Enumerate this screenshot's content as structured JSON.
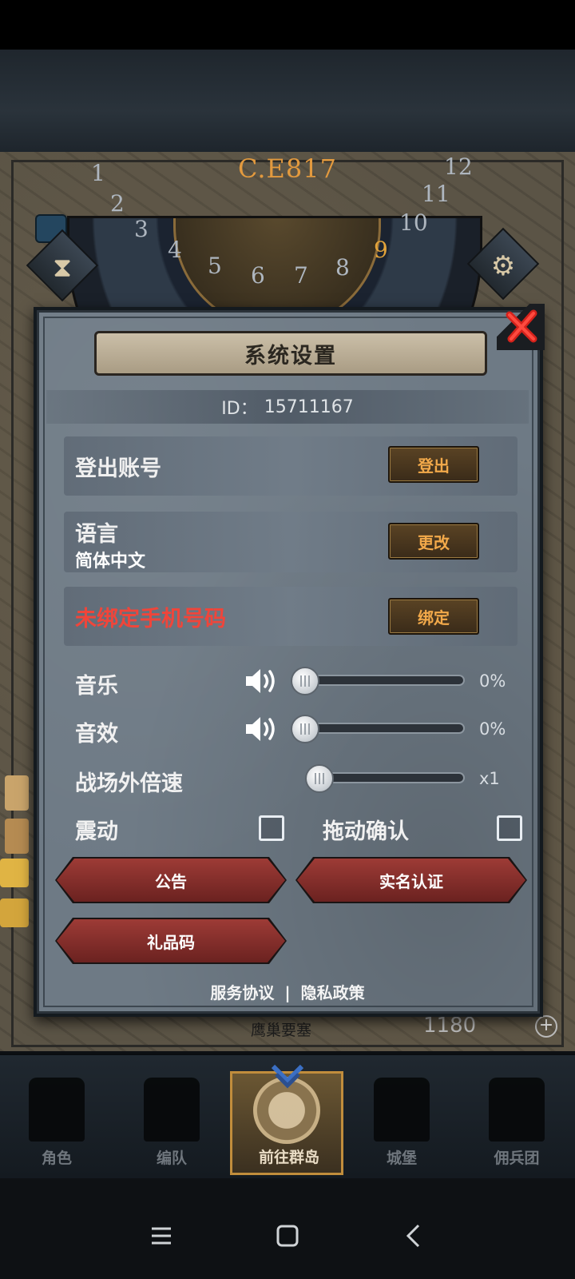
{
  "era": {
    "label": "C.E817",
    "dial_numbers": [
      "1",
      "2",
      "3",
      "4",
      "5",
      "6",
      "7",
      "8",
      "9",
      "10",
      "11",
      "12"
    ],
    "current": "9"
  },
  "dialog": {
    "title": "系统设置",
    "id_label": "ID：",
    "id_value": "15711167",
    "logout": {
      "label": "登出账号",
      "button": "登出"
    },
    "language": {
      "label": "语言",
      "value": "简体中文",
      "button": "更改"
    },
    "phone": {
      "label": "未绑定手机号码",
      "button": "绑定"
    },
    "music": {
      "label": "音乐",
      "value_text": "0%",
      "level": 0
    },
    "sfx": {
      "label": "音效",
      "value_text": "0%",
      "level": 0
    },
    "speed": {
      "label": "战场外倍速",
      "value_text": "x1",
      "level": 0
    },
    "vibrate": {
      "label": "震动",
      "checked": false
    },
    "drag_confirm": {
      "label": "拖动确认",
      "checked": false
    },
    "buttons": {
      "notice": "公告",
      "realname": "实名认证",
      "gift_code": "礼品码"
    },
    "links": {
      "terms": "服务协议",
      "separator": "|",
      "privacy": "隐私政策"
    }
  },
  "background": {
    "location_text": "鹰巢要塞",
    "resource_count": "1180"
  },
  "nav": {
    "items": [
      {
        "label": "角色",
        "icon": "knight-icon"
      },
      {
        "label": "编队",
        "icon": "formation-icon"
      },
      {
        "label": "前往群岛",
        "icon": "globe-icon"
      },
      {
        "label": "城堡",
        "icon": "castle-icon"
      },
      {
        "label": "佣兵团",
        "icon": "mercenary-icon"
      }
    ],
    "active_index": 2
  },
  "colors": {
    "alert_red": "#f0453a",
    "gold_text": "#f2a94a",
    "era_orange": "#e39a3e",
    "dialog_bg": "#6e7a85"
  }
}
